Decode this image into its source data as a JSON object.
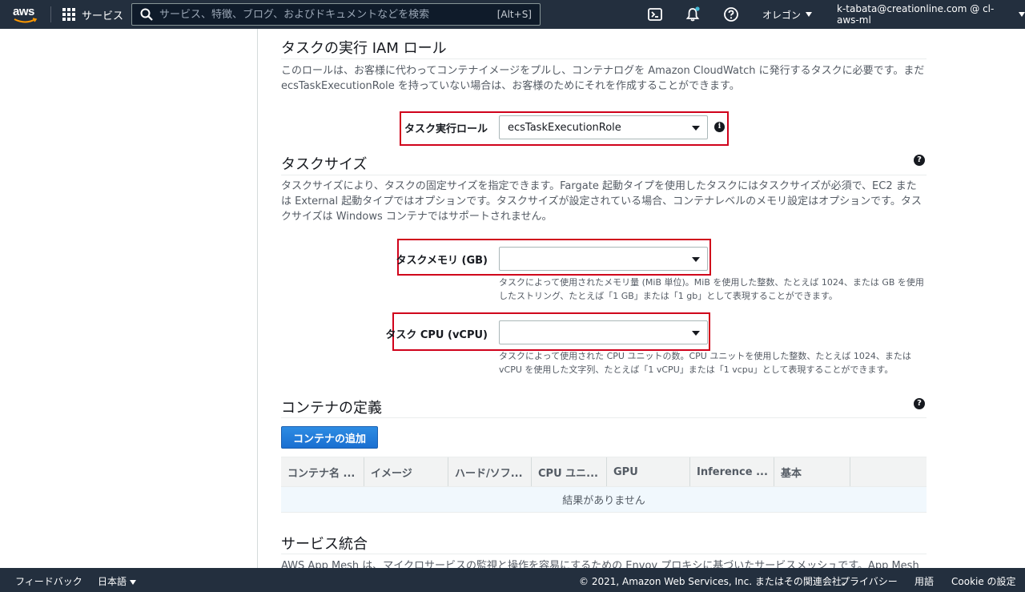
{
  "topnav": {
    "logo": "aws",
    "services_label": "サービス",
    "search_placeholder": "サービス、特徴、ブログ、およびドキュメントなどを検索",
    "search_shortcut": "[Alt+S]",
    "region_label": "オレゴン",
    "account_label": "k-tabata@creationline.com @ cl-aws-ml",
    "icons": [
      "cloudshell-icon",
      "bell-icon",
      "help-icon"
    ]
  },
  "task_role_section": {
    "title": "タスクの実行 IAM ロール",
    "description": "このロールは、お客様に代わってコンテナイメージをプルし、コンテナログを Amazon CloudWatch に発行するタスクに必要です。まだ ecsTaskExecutionRole を持っていない場合は、お客様のためにそれを作成することができます。",
    "field_label": "タスク実行ロール",
    "field_value": "ecsTaskExecutionRole"
  },
  "task_size_section": {
    "title": "タスクサイズ",
    "description": "タスクサイズにより、タスクの固定サイズを指定できます。Fargate 起動タイプを使用したタスクにはタスクサイズが必須で、EC2 または External 起動タイプではオプションです。タスクサイズが設定されている場合、コンテナレベルのメモリ設定はオプションです。タスクサイズは Windows コンテナではサポートされません。",
    "memory_label": "タスクメモリ (GB)",
    "memory_value": "",
    "memory_hint": "タスクによって使用されたメモリ量 (MiB 単位)。MiB を使用した整数、たとえば 1024、または GB を使用したストリング、たとえば「1 GB」または「1 gb」として表現することができます。",
    "cpu_label": "タスク CPU (vCPU)",
    "cpu_value": "",
    "cpu_hint": "タスクによって使用された CPU ユニットの数。CPU ユニットを使用した整数、たとえば 1024、または vCPU を使用した文字列、たとえば「1 vCPU」または「1 vcpu」として表現することができます。"
  },
  "container_section": {
    "title": "コンテナの定義",
    "add_button": "コンテナの追加",
    "columns": [
      "コンテナ名 ...",
      "イメージ",
      "ハード/ソフ...",
      "CPU ユニ...",
      "GPU",
      "Inference ...",
      "基本",
      ""
    ],
    "empty_text": "結果がありません"
  },
  "service_section": {
    "title": "サービス統合",
    "description": "AWS App Mesh は、マイクロサービスの監視と操作を容易にするための Envoy プロキシに基づいたサービスメッシュです。App Mesh"
  },
  "footer": {
    "feedback": "フィードバック",
    "language": "日本語",
    "copyright": "© 2021, Amazon Web Services, Inc. またはその関連会社。",
    "privacy": "プライバシー",
    "terms": "用語",
    "cookie": "Cookie の設定"
  },
  "colors": {
    "nav_bg": "#232f3e",
    "highlight_red": "#d0021b",
    "primary_blue": "#1a6fd1"
  }
}
